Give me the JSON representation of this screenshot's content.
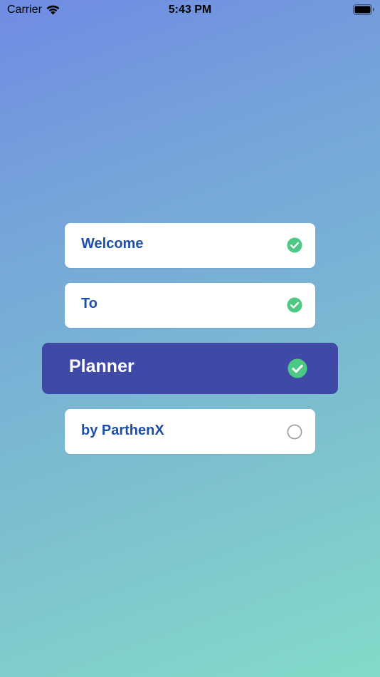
{
  "status_bar": {
    "carrier": "Carrier",
    "time": "5:43 PM",
    "wifi_icon": "wifi-icon",
    "battery_icon": "battery-icon"
  },
  "tasks": [
    {
      "label": "Welcome",
      "checked": true,
      "active": false
    },
    {
      "label": "To",
      "checked": true,
      "active": false
    },
    {
      "label": "Planner",
      "checked": true,
      "active": true
    },
    {
      "label": "by ParthenX",
      "checked": false,
      "active": false
    }
  ],
  "colors": {
    "check_green": "#4cc985",
    "text_blue": "#1d4fa8",
    "active_bg": "#3f4aa6",
    "unchecked_gray": "#9a9a9a"
  }
}
